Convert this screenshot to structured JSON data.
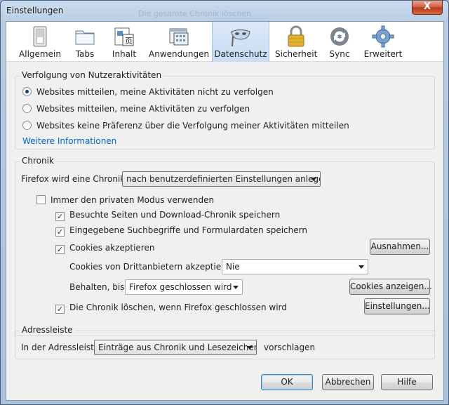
{
  "window": {
    "title": "Einstellungen",
    "ghost_title": "Die gesamte Chronik löschen",
    "close_label": "X"
  },
  "toolbar": {
    "panes": [
      {
        "label": "Allgemein",
        "icon": "switch-icon"
      },
      {
        "label": "Tabs",
        "icon": "tabs-folder-icon"
      },
      {
        "label": "Inhalt",
        "icon": "content-page-icon"
      },
      {
        "label": "Anwendungen",
        "icon": "applications-window-icon"
      },
      {
        "label": "Datenschutz",
        "icon": "mask-icon"
      },
      {
        "label": "Sicherheit",
        "icon": "padlock-icon"
      },
      {
        "label": "Sync",
        "icon": "sync-arrows-icon"
      },
      {
        "label": "Erweitert",
        "icon": "gear-icon"
      }
    ],
    "selected": "Datenschutz"
  },
  "tracking": {
    "title": "Verfolgung von Nutzeraktivitäten",
    "options": [
      "Websites mitteilen, meine Aktivitäten nicht zu verfolgen",
      "Websites mitteilen, meine Aktivitäten zu verfolgen",
      "Websites keine Präferenz über die Verfolgung meiner Aktivitäten mitteilen"
    ],
    "selected_index": 0,
    "more_info": "Weitere Informationen"
  },
  "history": {
    "title": "Chronik",
    "mode_label": "Firefox wird eine Chronik:",
    "mode_value": "nach benutzerdefinierten Einstellungen anlegen",
    "private_mode": {
      "label": "Immer den privaten Modus verwenden",
      "checked": false
    },
    "remember_browsing": {
      "label": "Besuchte Seiten und Download-Chronik speichern",
      "checked": true
    },
    "remember_forms": {
      "label": "Eingegebene Suchbegriffe und Formulardaten speichern",
      "checked": true
    },
    "accept_cookies": {
      "label": "Cookies akzeptieren",
      "checked": true
    },
    "exceptions_button": "Ausnahmen...",
    "third_party_label": "Cookies von Drittanbietern akzeptieren:",
    "third_party_value": "Nie",
    "keep_until_label": "Behalten, bis:",
    "keep_until_value": "Firefox geschlossen wird",
    "show_cookies_button": "Cookies anzeigen...",
    "clear_on_close": {
      "label": "Die Chronik löschen, wenn Firefox geschlossen wird",
      "checked": true
    },
    "settings_button": "Einstellungen..."
  },
  "addressbar": {
    "title": "Adressleiste",
    "prefix": "In der Adressleiste",
    "value": "Einträge aus Chronik und Lesezeichen",
    "suffix": "vorschlagen"
  },
  "footer": {
    "ok": "OK",
    "cancel": "Abbrechen",
    "help": "Hilfe"
  },
  "colors": {
    "link": "#0066cc",
    "selected_tab": "#c7dcf3",
    "close_button": "#c7462b"
  }
}
